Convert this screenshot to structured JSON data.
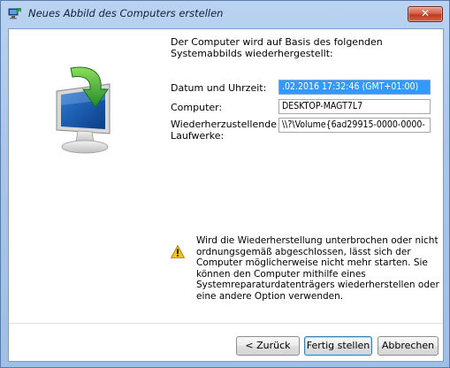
{
  "window": {
    "title": "Neues Abbild des Computers erstellen",
    "close_label": "✕"
  },
  "content": {
    "intro": "Der Computer wird auf Basis des folgenden Systemabbilds wiederhergestellt:",
    "fields": [
      {
        "label": "Datum und Uhrzeit:",
        "value": ".02.2016 17:32:46 (GMT+01:00)"
      },
      {
        "label": "Computer:",
        "value": "DESKTOP-MAGT7L7"
      },
      {
        "label": "Wiederherzustellende Laufwerke:",
        "value": "\\\\?\\Volume{6ad29915-0000-0000-"
      }
    ],
    "warning": "Wird die Wiederherstellung unterbrochen oder nicht ordnungsgemäß abgeschlossen, lässt sich der Computer möglicherweise nicht mehr starten. Sie können den Computer mithilfe eines Systemreparaturdatenträgers wiederherstellen oder eine andere Option verwenden."
  },
  "buttons": {
    "back": "< Zurück",
    "finish": "Fertig stellen",
    "cancel": "Abbrechen"
  },
  "icons": {
    "app": "restore-computer-icon",
    "graphic": "computer-restore-arrow-icon",
    "warning": "warning-icon",
    "close": "close-icon"
  }
}
